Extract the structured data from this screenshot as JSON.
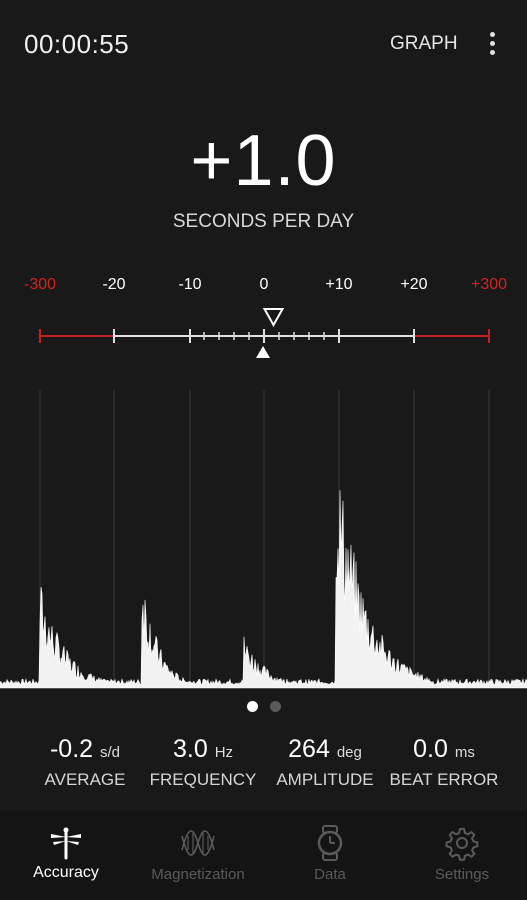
{
  "header": {
    "timer": "00:00:55",
    "graph_label": "GRAPH",
    "menu_icon": "more-vert-icon"
  },
  "reading": {
    "rate": "+1.0",
    "rate_label": "SECONDS PER DAY"
  },
  "scale": {
    "labels": [
      "-300",
      "-20",
      "-10",
      "0",
      "+10",
      "+20",
      "+300"
    ],
    "label_colors": [
      "#d12424",
      "#ffffff",
      "#ffffff",
      "#ffffff",
      "#ffffff",
      "#ffffff",
      "#d12424"
    ],
    "pointer_value": 1.0,
    "red_color": "#c42020",
    "track_color": "#e0e0e0"
  },
  "pager": {
    "active_index": 0,
    "count": 2,
    "active_color": "#ffffff",
    "inactive_color": "#5a5a5a"
  },
  "stats": [
    {
      "value": "-0.2",
      "unit": "s/d",
      "label": "AVERAGE"
    },
    {
      "value": "3.0",
      "unit": "Hz",
      "label": "FREQUENCY"
    },
    {
      "value": "264",
      "unit": "deg",
      "label": "AMPLITUDE"
    },
    {
      "value": "0.0",
      "unit": "ms",
      "label": "BEAT ERROR"
    }
  ],
  "nav": [
    {
      "label": "Accuracy",
      "icon": "dragonfly-icon",
      "active": true
    },
    {
      "label": "Magnetization",
      "icon": "wave-icon",
      "active": false
    },
    {
      "label": "Data",
      "icon": "watch-icon",
      "active": false
    },
    {
      "label": "Settings",
      "icon": "gear-icon",
      "active": false
    }
  ]
}
